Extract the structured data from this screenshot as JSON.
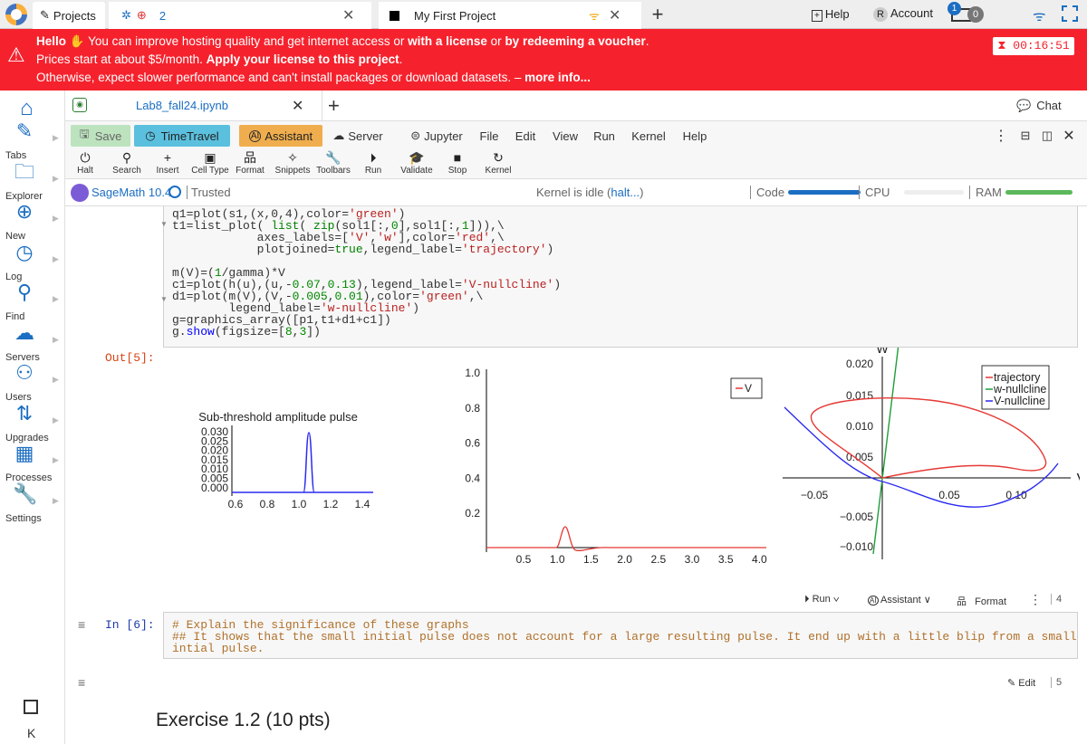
{
  "topbar": {
    "projects_label": "Projects",
    "tab_count": "2",
    "project_title": "My First Project",
    "help_label": "Help",
    "account_label": "Account",
    "account_initial": "R",
    "notif_count": "1",
    "balance": "0"
  },
  "banner": {
    "hello": "Hello",
    "line1_a": "You can improve hosting quality and get internet access or",
    "line1_b": "with a license",
    "line1_c": "or",
    "line1_d": "by redeeming a voucher",
    "line2_a": "Prices start at about $5/month.",
    "line2_b": "Apply your license to this project",
    "line3_a": "Otherwise, expect slower performance and can't install packages or download datasets. –",
    "line3_b": "more info...",
    "timer": "00:16:51"
  },
  "nav": [
    {
      "label": "Tabs",
      "icon": "pencil-icon"
    },
    {
      "label": "Explorer",
      "icon": "folder-icon"
    },
    {
      "label": "New",
      "icon": "plus-circle-icon"
    },
    {
      "label": "Log",
      "icon": "history-icon"
    },
    {
      "label": "Find",
      "icon": "search-icon"
    },
    {
      "label": "Servers",
      "icon": "server-icon"
    },
    {
      "label": "Users",
      "icon": "add-user-icon"
    },
    {
      "label": "Upgrades",
      "icon": "upgrade-icon"
    },
    {
      "label": "Processes",
      "icon": "processor-icon"
    },
    {
      "label": "Settings",
      "icon": "wrench-icon"
    }
  ],
  "nav_bottom_letter": "K",
  "filetab": {
    "name": "Lab8_fall24.ipynb",
    "chat": "Chat"
  },
  "toolbar1": {
    "save": "Save",
    "timetravel": "TimeTravel",
    "assistant": "Assistant",
    "server": "Server",
    "jupyter": "Jupyter",
    "file": "File",
    "edit": "Edit",
    "view": "View",
    "run": "Run",
    "kernel": "Kernel",
    "help": "Help"
  },
  "toolbar2": [
    "Halt",
    "Search",
    "Insert",
    "Cell Type",
    "Format",
    "Snippets",
    "Toolbars",
    "Run",
    "Validate",
    "Stop",
    "Kernel"
  ],
  "kernelbar": {
    "kernel": "SageMath 10.4",
    "trusted": "Trusted",
    "status_a": "Kernel is idle (",
    "status_b": "halt...",
    "status_c": ")",
    "code": "Code",
    "cpu": "CPU",
    "ram": "RAM"
  },
  "cell5": {
    "out_prompt": "Out[5]:"
  },
  "plot1": {
    "title": "Sub-threshold amplitude pulse",
    "yticks": [
      "0.030",
      "0.025",
      "0.020",
      "0.015",
      "0.010",
      "0.005",
      "0.000"
    ],
    "xticks": [
      "0.6",
      "0.8",
      "1.0",
      "1.2",
      "1.4"
    ]
  },
  "plot2": {
    "legend": "V",
    "yticks": [
      "1.0",
      "0.8",
      "0.6",
      "0.4",
      "0.2"
    ],
    "xticks": [
      "0.5",
      "1.0",
      "1.5",
      "2.0",
      "2.5",
      "3.0",
      "3.5",
      "4.0"
    ]
  },
  "plot3": {
    "ylabel": "W",
    "xlabel": "V",
    "yticks": [
      "0.020",
      "0.015",
      "0.010",
      "0.005",
      "−0.005",
      "−0.010"
    ],
    "xticks": [
      "−0.05",
      "0.05",
      "0.10"
    ],
    "legend": [
      "trajectory",
      "w-nullcline",
      "V-nullcline"
    ],
    "colors": {
      "trajectory": "#e53935",
      "w_nullcline": "#1e9e3a",
      "v_nullcline": "#2b2bf0"
    }
  },
  "celltoolbar": {
    "run": "Run",
    "assistant": "Assistant",
    "format": "Format",
    "num": "4"
  },
  "cell6": {
    "prompt": "In [6]:",
    "line1": "# Explain the significance of these graphs",
    "line2": "## It shows that the small initial pulse does not account for a large resulting pulse. It end up with a little blip from a small",
    "line3": "intial pulse."
  },
  "mdcell": {
    "edit": "Edit",
    "num": "5",
    "heading": "Exercise 1.2 (10 pts)"
  }
}
